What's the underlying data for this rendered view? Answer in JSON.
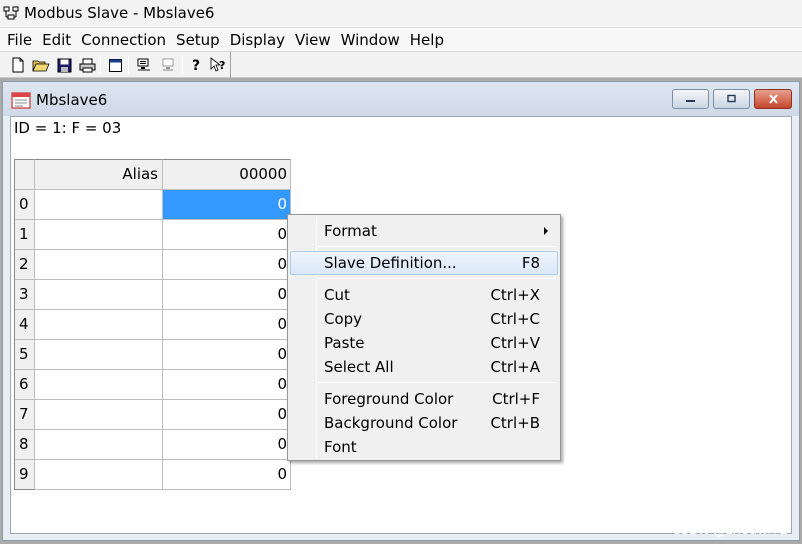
{
  "window": {
    "title": "Modbus Slave - Mbslave6"
  },
  "menu": [
    "File",
    "Edit",
    "Connection",
    "Setup",
    "Display",
    "View",
    "Window",
    "Help"
  ],
  "toolbar_icons": [
    "new-icon",
    "open-icon",
    "save-icon",
    "print-icon",
    "window-icon",
    "connect-icon",
    "disconnect-icon",
    "help-icon",
    "context-help-icon"
  ],
  "child": {
    "title": "Mbslave6",
    "status": "ID = 1: F = 03",
    "columns": {
      "alias": "Alias",
      "address": "00000"
    },
    "rows": [
      {
        "index": "0",
        "value": "0"
      },
      {
        "index": "1",
        "value": "0"
      },
      {
        "index": "2",
        "value": "0"
      },
      {
        "index": "3",
        "value": "0"
      },
      {
        "index": "4",
        "value": "0"
      },
      {
        "index": "5",
        "value": "0"
      },
      {
        "index": "6",
        "value": "0"
      },
      {
        "index": "7",
        "value": "0"
      },
      {
        "index": "8",
        "value": "0"
      },
      {
        "index": "9",
        "value": "0"
      }
    ]
  },
  "context_menu": [
    {
      "label": "Format",
      "shortcut": "",
      "submenu": true
    },
    {
      "label": "Slave Definition...",
      "shortcut": "F8",
      "highlighted": true
    },
    {
      "label": "Cut",
      "shortcut": "Ctrl+X"
    },
    {
      "label": "Copy",
      "shortcut": "Ctrl+C"
    },
    {
      "label": "Paste",
      "shortcut": "Ctrl+V"
    },
    {
      "label": "Select All",
      "shortcut": "Ctrl+A"
    },
    {
      "label": "Foreground Color",
      "shortcut": "Ctrl+F"
    },
    {
      "label": "Background Color",
      "shortcut": "Ctrl+B"
    },
    {
      "label": "Font",
      "shortcut": ""
    }
  ],
  "watermark": "CSDN @zhouwl72",
  "colors": {
    "selection": "#3399ff",
    "highlight": "#dbe8f8",
    "close_button": "#c5452b"
  }
}
